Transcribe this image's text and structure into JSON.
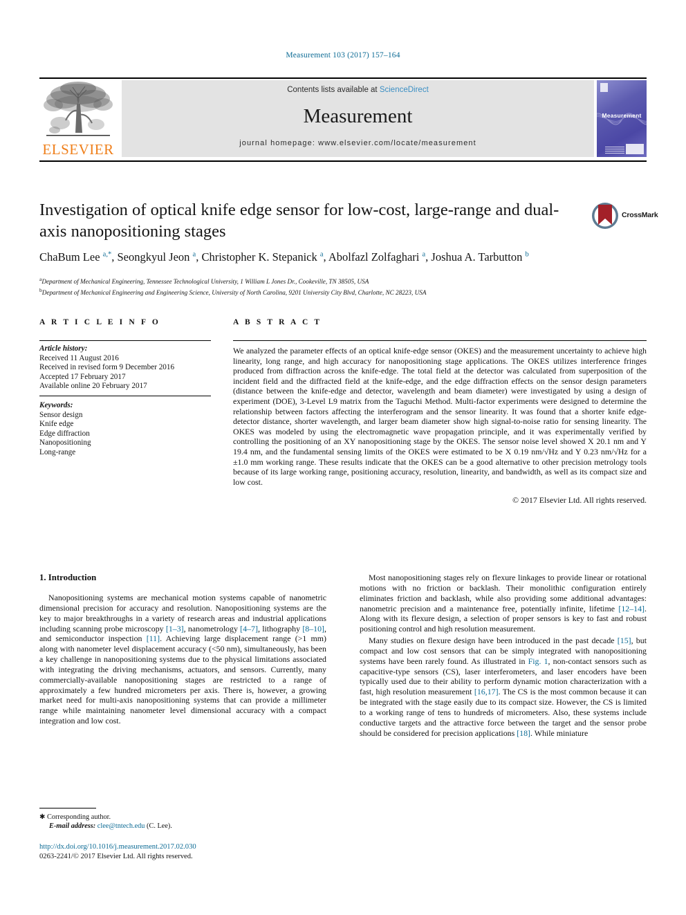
{
  "running_head": "Measurement 103 (2017) 157–164",
  "journal_header": {
    "contents_prefix": "Contents lists available at ",
    "sciencedirect": "ScienceDirect",
    "journal_name": "Measurement",
    "homepage": "journal homepage: www.elsevier.com/locate/measurement",
    "publisher_logo_text": "ELSEVIER",
    "cover_title": "Measurement"
  },
  "article": {
    "title": "Investigation of optical knife edge sensor for low-cost, large-range and dual-axis nanopositioning stages",
    "crossmark_label": "CrossMark",
    "authors_html": "ChaBum Lee <sup>a,*</sup>, Seongkyul Jeon <sup>a</sup>, Christopher K. Stepanick <sup>a</sup>, Abolfazl Zolfaghari <sup>a</sup>, Joshua A. Tarbutton <sup>b</sup>",
    "affiliations": [
      "Department of Mechanical Engineering, Tennessee Technological University, 1 William L Jones Dr., Cookeville, TN 38505, USA",
      "Department of Mechanical Engineering and Engineering Science, University of North Carolina, 9201 University City Blvd, Charlotte, NC 28223, USA"
    ]
  },
  "article_info": {
    "heading": "A R T I C L E   I N F O",
    "history_label": "Article history:",
    "history": [
      "Received 11 August 2016",
      "Received in revised form 9 December 2016",
      "Accepted 17 February 2017",
      "Available online 20 February 2017"
    ],
    "keywords_label": "Keywords:",
    "keywords": [
      "Sensor design",
      "Knife edge",
      "Edge diffraction",
      "Nanopositioning",
      "Long-range"
    ]
  },
  "abstract": {
    "heading": "A B S T R A C T",
    "text": "We analyzed the parameter effects of an optical knife-edge sensor (OKES) and the measurement uncertainty to achieve high linearity, long range, and high accuracy for nanopositioning stage applications. The OKES utilizes interference fringes produced from diffraction across the knife-edge. The total field at the detector was calculated from superposition of the incident field and the diffracted field at the knife-edge, and the edge diffraction effects on the sensor design parameters (distance between the knife-edge and detector, wavelength and beam diameter) were investigated by using a design of experiment (DOE), 3-Level L9 matrix from the Taguchi Method. Multi-factor experiments were designed to determine the relationship between factors affecting the interferogram and the sensor linearity. It was found that a shorter knife edge-detector distance, shorter wavelength, and larger beam diameter show high signal-to-noise ratio for sensing linearity. The OKES was modeled by using the electromagnetic wave propagation principle, and it was experimentally verified by controlling the positioning of an XY nanopositioning stage by the OKES. The sensor noise level showed X 20.1 nm and Y 19.4 nm, and the fundamental sensing limits of the OKES were estimated to be X 0.19 nm/√Hz and Y 0.23 nm/√Hz for a ±1.0 mm working range. These results indicate that the OKES can be a good alternative to other precision metrology tools because of its large working range, positioning accuracy, resolution, linearity, and bandwidth, as well as its compact size and low cost.",
    "copyright": "© 2017 Elsevier Ltd. All rights reserved."
  },
  "body": {
    "section_heading": "1. Introduction",
    "left_paragraphs": [
      "Nanopositioning systems are mechanical motion systems capable of nanometric dimensional precision for accuracy and resolution. Nanopositioning systems are the key to major breakthroughs in a variety of research areas and industrial applications including scanning probe microscopy [1–3], nanometrology [4–7], lithography [8–10], and semiconductor inspection [11]. Achieving large displacement range (>1 mm) along with nanometer level displacement accuracy (<50 nm), simultaneously, has been a key challenge in nanopositioning systems due to the physical limitations associated with integrating the driving mechanisms, actuators, and sensors. Currently, many commercially-available nanopositioning stages are restricted to a range of approximately a few hundred micrometers per axis. There is, however, a growing market need for multi-axis nanopositioning systems that can provide a millimeter range while maintaining nanometer level dimensional accuracy with a compact integration and low cost."
    ],
    "right_paragraphs": [
      "Most nanopositioning stages rely on flexure linkages to provide linear or rotational motions with no friction or backlash. Their monolithic configuration entirely eliminates friction and backlash, while also providing some additional advantages: nanometric precision and a maintenance free, potentially infinite, lifetime [12–14]. Along with its flexure design, a selection of proper sensors is key to fast and robust positioning control and high resolution measurement.",
      "Many studies on flexure design have been introduced in the past decade [15], but compact and low cost sensors that can be simply integrated with nanopositioning systems have been rarely found. As illustrated in Fig. 1, non-contact sensors such as capacitive-type sensors (CS), laser interferometers, and laser encoders have been typically used due to their ability to perform dynamic motion characterization with a fast, high resolution measurement [16,17]. The CS is the most common because it can be integrated with the stage easily due to its compact size. However, the CS is limited to a working range of tens to hundreds of micrometers. Also, these systems include conductive targets and the attractive force between the target and the sensor probe should be considered for precision applications [18]. While miniature"
    ]
  },
  "footnote": {
    "corresponding": "Corresponding author.",
    "email_label": "E-mail address:",
    "email": "clee@tntech.edu",
    "email_suffix": "(C. Lee)."
  },
  "footer": {
    "doi": "http://dx.doi.org/10.1016/j.measurement.2017.02.030",
    "issn_copyright": "0263-2241/© 2017 Elsevier Ltd. All rights reserved."
  },
  "colors": {
    "link_blue": "#0b6a94",
    "sciencedirect_blue": "#3b8fc4",
    "elsevier_orange": "#ef7f1a",
    "band_grey": "#e3e3e3",
    "cover_purple": "#5d5cb0",
    "crossmark_red": "#a32028"
  }
}
